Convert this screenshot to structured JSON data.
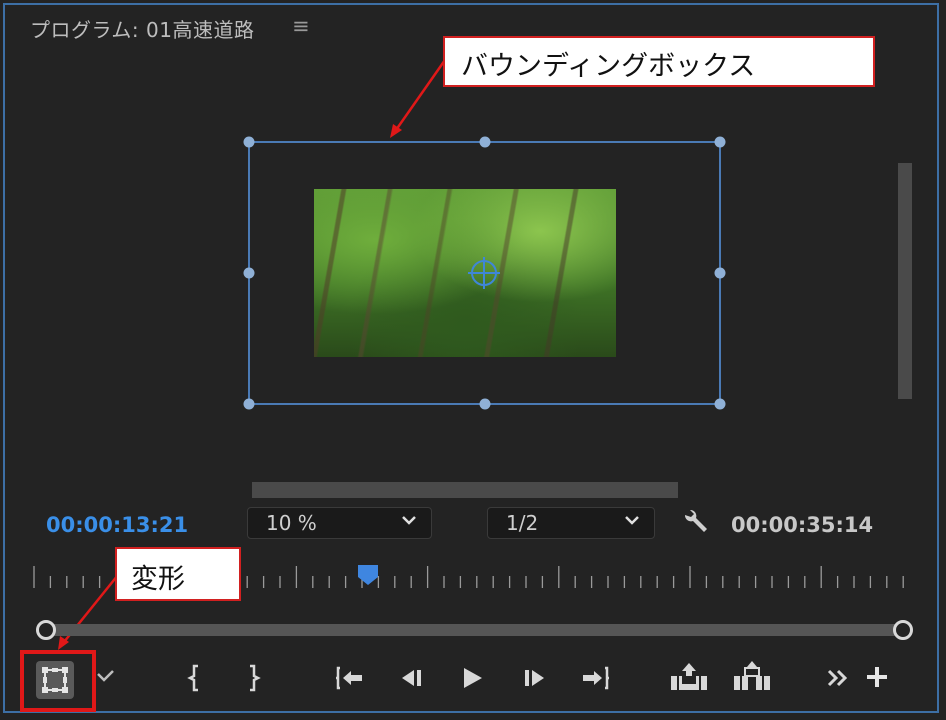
{
  "panel": {
    "title": "プログラム: 01高速道路",
    "menu_icon": "≡"
  },
  "callouts": {
    "bounding_box": "バウンディングボックス",
    "transform": "変形"
  },
  "timecodes": {
    "current": "00:00:13:21",
    "duration": "00:00:35:14"
  },
  "dropdowns": {
    "zoom": "10 %",
    "resolution": "1/2"
  },
  "timeline": {
    "playhead_fraction": 0.38
  },
  "colors": {
    "accent": "#3a8fe8",
    "callout_border": "#d12020",
    "bbox": "#4a7ab5"
  },
  "controls": [
    {
      "icon": "transform-icon"
    },
    {
      "icon": "checkmark-dropdown-icon"
    },
    {
      "icon": "mark-in-icon"
    },
    {
      "icon": "mark-out-icon"
    },
    {
      "icon": "go-to-in-icon"
    },
    {
      "icon": "step-back-icon"
    },
    {
      "icon": "play-icon"
    },
    {
      "icon": "step-forward-icon"
    },
    {
      "icon": "go-to-out-icon"
    },
    {
      "icon": "lift-icon"
    },
    {
      "icon": "extract-icon"
    },
    {
      "icon": "more-icon"
    },
    {
      "icon": "add-button-icon"
    }
  ]
}
